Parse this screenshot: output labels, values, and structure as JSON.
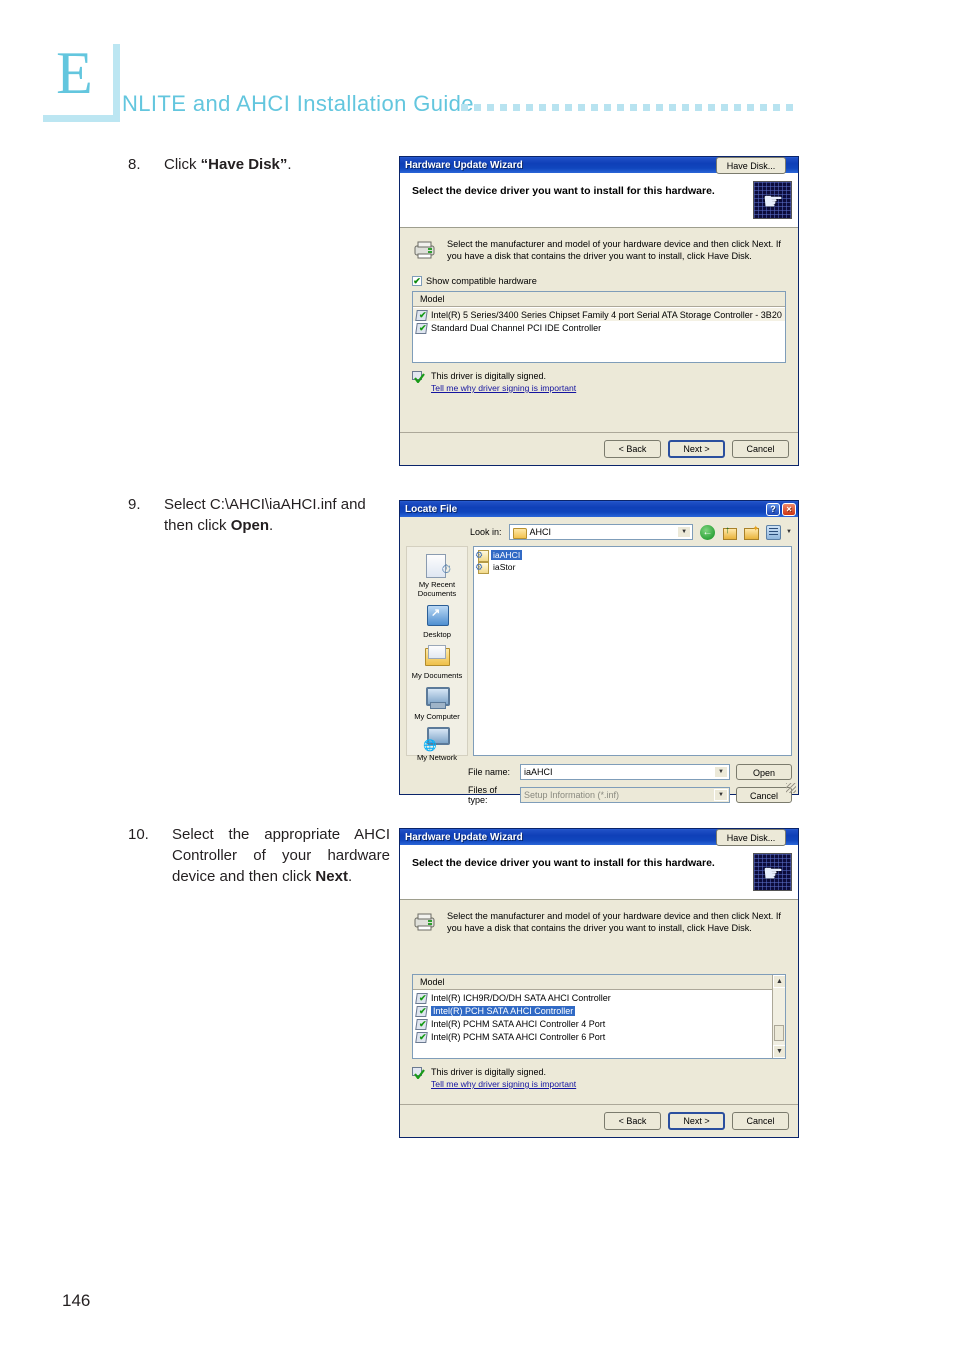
{
  "header": {
    "letter": "E",
    "title": "NLITE and AHCI Installation Guide",
    "dot_count": 26,
    "accent_color": "#63c6de",
    "dot_color": "#b8e3f0"
  },
  "page_number": "146",
  "steps": [
    {
      "number": "8.",
      "text_parts": [
        {
          "t": "Click ",
          "bold": false
        },
        {
          "t": "“Have Disk”",
          "bold": true
        },
        {
          "t": ".",
          "bold": false
        }
      ],
      "plain": "Click “Have Disk”."
    },
    {
      "number": "9.",
      "plain": "Select  C:\\AHCI\\iaAHCI.inf and then click Open.",
      "line1": "Select  C:\\AHCI\\iaAHCI.inf",
      "line2_pre": "and then click ",
      "line2_bold": "Open",
      "line2_post": "."
    },
    {
      "number": "10.",
      "plain": "Select the appropriate AHCI Controller of your hardware device and then click Next.",
      "pre": "Select the appropriate AHCI Controller of your hardware device and then click ",
      "bold": "Next",
      "post": "."
    }
  ],
  "dialog1": {
    "title": "Hardware Update Wizard",
    "heading": "Select the device driver you want to install for this hardware.",
    "description": "Select the manufacturer and model of your hardware device and then click Next. If you have a disk that contains the driver you want to install, click Have Disk.",
    "checkbox_label": "Show compatible hardware",
    "checkbox_checked": true,
    "list_header": "Model",
    "list_items": [
      {
        "label": "Intel(R) 5 Series/3400 Series Chipset Family 4 port Serial ATA Storage Controller - 3B20",
        "selected": false,
        "highlight": true
      },
      {
        "label": "Standard Dual Channel PCI IDE Controller",
        "selected": false,
        "highlight": false
      }
    ],
    "signed_text": "This driver is digitally signed.",
    "signing_link": "Tell me why driver signing is important",
    "have_disk_label": "Have Disk...",
    "buttons": [
      "< Back",
      "Next >",
      "Cancel"
    ],
    "default_button": "Next >",
    "scrollbar": false,
    "device_icon": "printer-icon",
    "wizard_icon": "hand-holding-card-icon"
  },
  "dialog2": {
    "title": "Locate File",
    "help_button": "?",
    "close_button": "×",
    "look_in_label": "Look in:",
    "look_in_value": "AHCI",
    "toolbar_icons": [
      "back-icon",
      "up-one-level-icon",
      "new-folder-icon",
      "views-icon"
    ],
    "places": [
      {
        "label": "My Recent Documents",
        "icon": "recent-documents-icon"
      },
      {
        "label": "Desktop",
        "icon": "desktop-icon"
      },
      {
        "label": "My Documents",
        "icon": "my-documents-icon"
      },
      {
        "label": "My Computer",
        "icon": "my-computer-icon"
      },
      {
        "label": "My Network",
        "icon": "my-network-places-icon"
      }
    ],
    "files": [
      {
        "name": "iaAHCI",
        "selected": true,
        "icon": "inf-file-icon"
      },
      {
        "name": "iaStor",
        "selected": false,
        "icon": "inf-file-icon"
      }
    ],
    "file_name_label": "File name:",
    "file_name_value": "iaAHCI",
    "files_of_type_label": "Files of type:",
    "files_of_type_value": "Setup Information (*.inf)",
    "files_of_type_disabled": true,
    "open_button": "Open",
    "cancel_button": "Cancel"
  },
  "dialog3": {
    "title": "Hardware Update Wizard",
    "heading": "Select the device driver you want to install for this hardware.",
    "description": "Select the manufacturer and model of your hardware device and then click Next. If you have a disk that contains the driver you want to install, click Have Disk.",
    "list_header": "Model",
    "list_items": [
      {
        "label": "Intel(R) ICH9R/DO/DH SATA AHCI Controller",
        "selected": false
      },
      {
        "label": "Intel(R) PCH SATA AHCI Controller",
        "selected": true
      },
      {
        "label": "Intel(R) PCHM SATA AHCI Controller 4 Port",
        "selected": false
      },
      {
        "label": "Intel(R) PCHM SATA AHCI Controller 6 Port",
        "selected": false
      }
    ],
    "signed_text": "This driver is digitally signed.",
    "signing_link": "Tell me why driver signing is important",
    "have_disk_label": "Have Disk...",
    "buttons": [
      "< Back",
      "Next >",
      "Cancel"
    ],
    "default_button": "Next >",
    "scrollbar": true,
    "scroll_up_glyph": "▲",
    "scroll_down_glyph": "▼"
  }
}
